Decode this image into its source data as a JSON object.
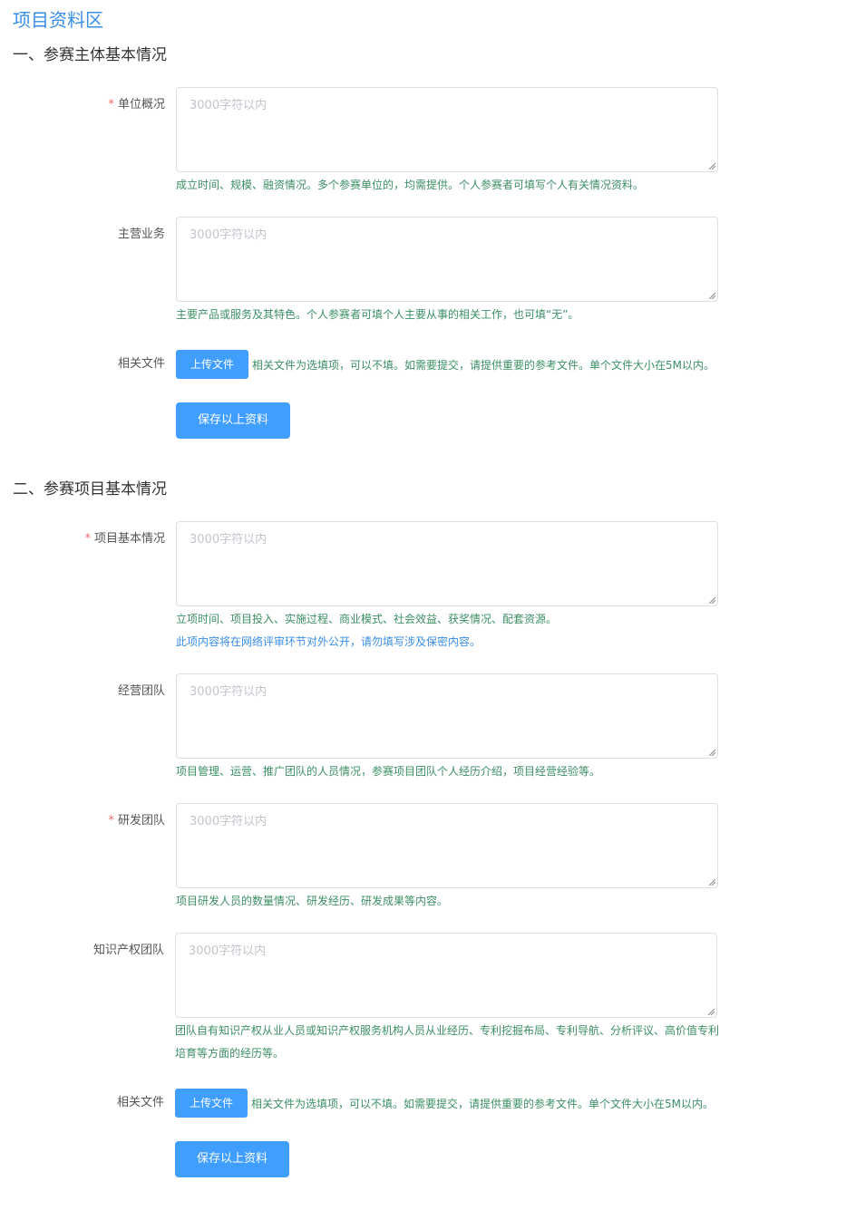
{
  "page_title": "项目资料区",
  "section1": {
    "title": "一、参赛主体基本情况",
    "unit_overview": {
      "required_mark": "*",
      "label": "单位概况",
      "placeholder": "3000字符以内",
      "hint": "成立时间、规模、融资情况。多个参赛单位的，均需提供。个人参赛者可填写个人有关情况资料。"
    },
    "main_business": {
      "label": "主营业务",
      "placeholder": "3000字符以内",
      "hint": "主要产品或服务及其特色。个人参赛者可填个人主要从事的相关工作，也可填“无”。"
    },
    "files": {
      "label": "相关文件",
      "upload_label": "上传文件",
      "note": "相关文件为选填项，可以不填。如需要提交，请提供重要的参考文件。单个文件大小在5M以内。"
    },
    "save_label": "保存以上资料"
  },
  "section2": {
    "title": "二、参赛项目基本情况",
    "project_basic": {
      "required_mark": "*",
      "label": "项目基本情况",
      "placeholder": "3000字符以内",
      "hint": "立项时间、项目投入、实施过程、商业模式、社会效益、获奖情况、配套资源。",
      "hint2": "此项内容将在网络评审环节对外公开，请勿填写涉及保密内容。"
    },
    "operation_team": {
      "label": "经营团队",
      "placeholder": "3000字符以内",
      "hint": "项目管理、运营、推广团队的人员情况，参赛项目团队个人经历介绍，项目经营经验等。"
    },
    "rd_team": {
      "required_mark": "*",
      "label": "研发团队",
      "placeholder": "3000字符以内",
      "hint": "项目研发人员的数量情况、研发经历、研发成果等内容。"
    },
    "ip_team": {
      "label": "知识产权团队",
      "placeholder": "3000字符以内",
      "hint_line1": "团队自有知识产权从业人员或知识产权服务机构人员从业经历、专利挖掘布局、专利导航、分析评议、高价值专利",
      "hint_line2": "培育等方面的经历等。"
    },
    "files": {
      "label": "相关文件",
      "upload_label": "上传文件",
      "note": "相关文件为选填项，可以不填。如需要提交，请提供重要的参考文件。单个文件大小在5M以内。"
    },
    "save_label": "保存以上资料"
  }
}
